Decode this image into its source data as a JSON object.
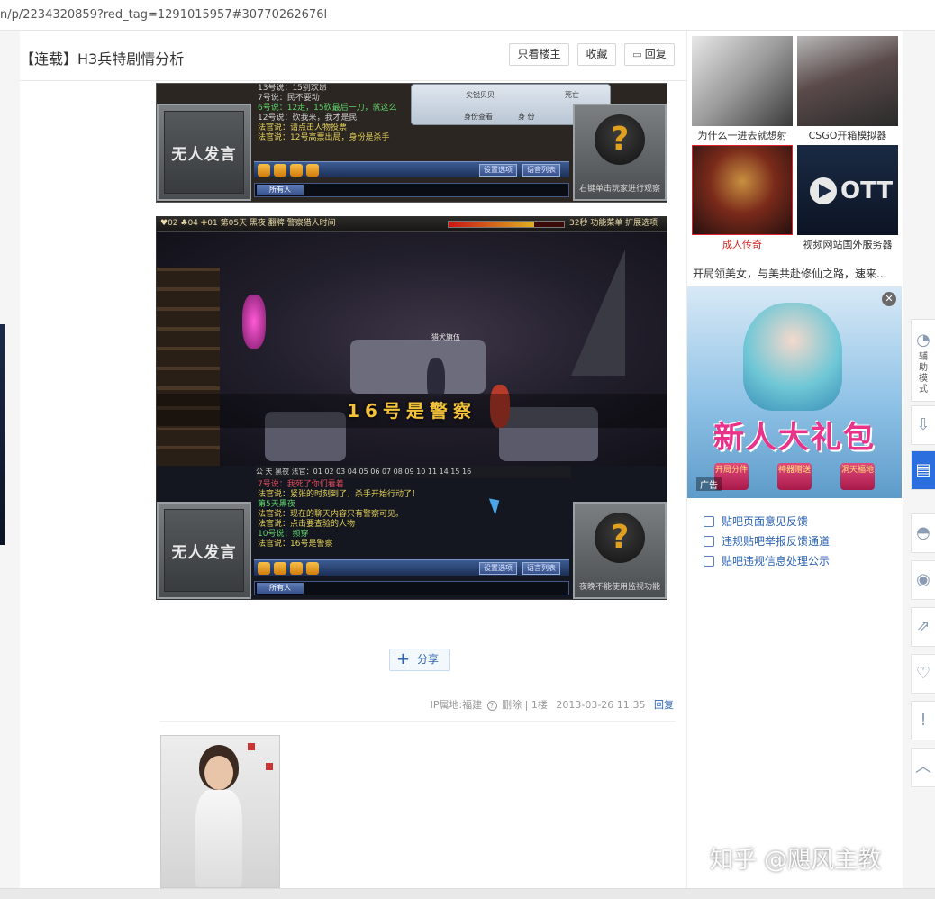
{
  "browser": {
    "url_fragment": "n/p/2234320859?red_tag=1291015957#30770262676l"
  },
  "thread": {
    "title": "【连载】H3兵特剧情分析",
    "buttons": {
      "only_op": "只看楼主",
      "favorite": "收藏",
      "reply": "回复"
    }
  },
  "screenshot_top": {
    "chat_lines": [
      "13号说：15别欢昂",
      "7号说：民不要动",
      "6号说：12走，15砍最后一刀，就这么",
      "12号说：砍我来，我才是民",
      "法官说：请点击人物投票",
      "法官说：12号高票出局，身份是杀手"
    ],
    "panel_text": "无人发言",
    "right_caption": "右键单击玩家进行观察",
    "mini_labels": [
      "尖锐贝贝",
      "死亡",
      "身份查看",
      "身 份"
    ],
    "toolbar_buttons": [
      "设置选项",
      "语音列表"
    ],
    "who": "所有人"
  },
  "screenshot_main": {
    "hud": "♥02  ♣04  ✚01    第05天  黑夜   翻牌    警察猎人时间",
    "hud_right": "32秒  功能菜单  扩展选项",
    "hp_fraction": 0.74,
    "banner": "16号是警察",
    "tag_label": "猎犬旗伍",
    "chat_tabs": "公 天  黑夜   法官：01  02  03  04  05  06  07  08  09  10  11  14  15  16",
    "chat_lines": [
      "7号说：我死了你们看着",
      "法官说：紧张的时刻到了，杀手开始行动了！",
      "第5天黑夜",
      "法官说：现在的聊天内容只有警察可见。",
      "法官说：点击要查验的人物",
      "10号说：频穿",
      "法官说：16号是警察"
    ],
    "panel_text": "无人发言",
    "right_caption": "夜晚不能使用监视功能",
    "toolbar_buttons": [
      "设置选项",
      "语言列表"
    ],
    "who": "所有人"
  },
  "share": {
    "label": "分享"
  },
  "floor_meta": {
    "ip": "IP属地:福建",
    "delete": "删除",
    "floor": "1楼",
    "time": "2013-03-26 11:35",
    "reply": "回复"
  },
  "sidebar": {
    "thumbs": [
      {
        "caption": "为什么一进去就想射"
      },
      {
        "caption": "CSGO开箱模拟器"
      },
      {
        "caption": "成人传奇"
      },
      {
        "caption": "视频网站国外服务器"
      }
    ],
    "ad_title": "开局领美女，与美共赴修仙之路，速来...",
    "ad_headline": "新人大礼包",
    "ad_badges": [
      "开局分件",
      "神器赠送",
      "洞天福地"
    ],
    "ad_label": "广告",
    "links": [
      "贴吧页面意见反馈",
      "违规贴吧举报反馈通道",
      "贴吧违规信息处理公示"
    ]
  },
  "float_bar": {
    "assist_label": "辅助模式"
  },
  "watermark": "知乎 @飓风主教",
  "colors": {
    "link_blue": "#2d64b3",
    "active_blue": "#2b6fde",
    "ad_pink": "#e9328a"
  }
}
